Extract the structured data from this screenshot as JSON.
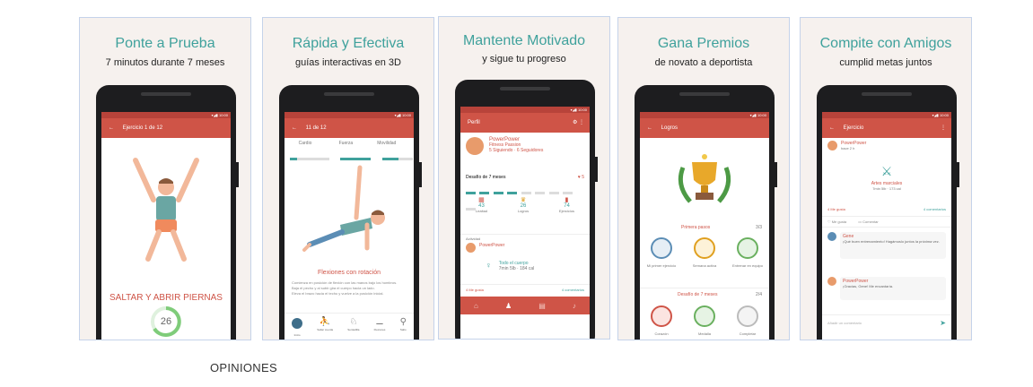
{
  "colors": {
    "accent_teal": "#3fa19c",
    "app_red": "#cf5447",
    "card_bg": "#f6f1ee"
  },
  "cards": [
    {
      "title": "Ponte a Prueba",
      "subtitle": "7 minutos durante 7 meses",
      "screen": {
        "appbar_title": "Ejercicio 1 de 12",
        "exercise_name": "SALTAR Y ABRIR PIERNAS",
        "timer_value": "26"
      }
    },
    {
      "title": "Rápida y Efectiva",
      "subtitle": "guías interactivas en 3D",
      "screen": {
        "appbar_title": "11 de 12",
        "tabs": [
          "Cardio",
          "Fuerza",
          "Movilidad"
        ],
        "exercise_name": "Flexiones con rotación",
        "steps": [
          "Comienza en posición de flexión con las manos bajo los hombros.",
          "Baja el pecho y al subir gira el cuerpo hacia un lado.",
          "Eleva el brazo hacia el techo y vuelve a la posición inicial."
        ],
        "nav": [
          "Inicio",
          "Saltar cuerda",
          "Sentadilla",
          "Flexiones",
          "Salto"
        ]
      }
    },
    {
      "title": "Mantente Motivado",
      "subtitle": "y sigue tu progreso",
      "screen": {
        "appbar_title": "Perfil",
        "username": "PowerPower",
        "user_line1": "Fitness Passion",
        "user_line2": "5 Siguiendo · 6 Seguidores",
        "challenge_label": "Desafío de 7 meses",
        "challenge_count": "5",
        "stats": [
          {
            "value": "43",
            "label": "Lealtad"
          },
          {
            "value": "26",
            "label": "Logros"
          },
          {
            "value": "74",
            "label": "Ejercicios"
          }
        ],
        "activity_label": "Actividad",
        "activity_user": "PowerPower",
        "activity_text": "Todo el cuerpo",
        "activity_meta": "7min 5lb · 184 cal",
        "like_text": "4 Me gusta",
        "comments_text": "4 comentarios"
      }
    },
    {
      "title": "Gana Premios",
      "subtitle": "de novato a deportista",
      "screen": {
        "appbar_title": "Logros",
        "section1_label": "Primera pasos",
        "section1_count": "3/3",
        "badges": [
          "Mi primer ejercicio",
          "Semana activa",
          "Entrenar en equipo"
        ],
        "section2_label": "Desafío de 7 meses",
        "section2_count": "2/4",
        "badges2": [
          "Corazón",
          "Medalla",
          "Completar"
        ]
      }
    },
    {
      "title": "Compite con Amigos",
      "subtitle": "cumplid metas juntos",
      "screen": {
        "appbar_title": "Ejercicio",
        "post_user": "PowerPower",
        "post_time": "hace 2 h",
        "post_activity": "Artes marciales",
        "post_meta": "7min 5lb · 173 cal",
        "like_text": "4 Me gusta",
        "comments_text": "4 comentarios",
        "comment1_user": "Gene",
        "comment1_text": "¡Qué buen entrenamiento! Hagámoslo juntos la próxima vez.",
        "comment2_user": "PowerPower",
        "comment2_text": "¡Gracias, Gene! Me encantaría.",
        "input_placeholder": "Añadir un comentario"
      }
    }
  ],
  "footer": {
    "opiniones": "OPINIONES"
  }
}
